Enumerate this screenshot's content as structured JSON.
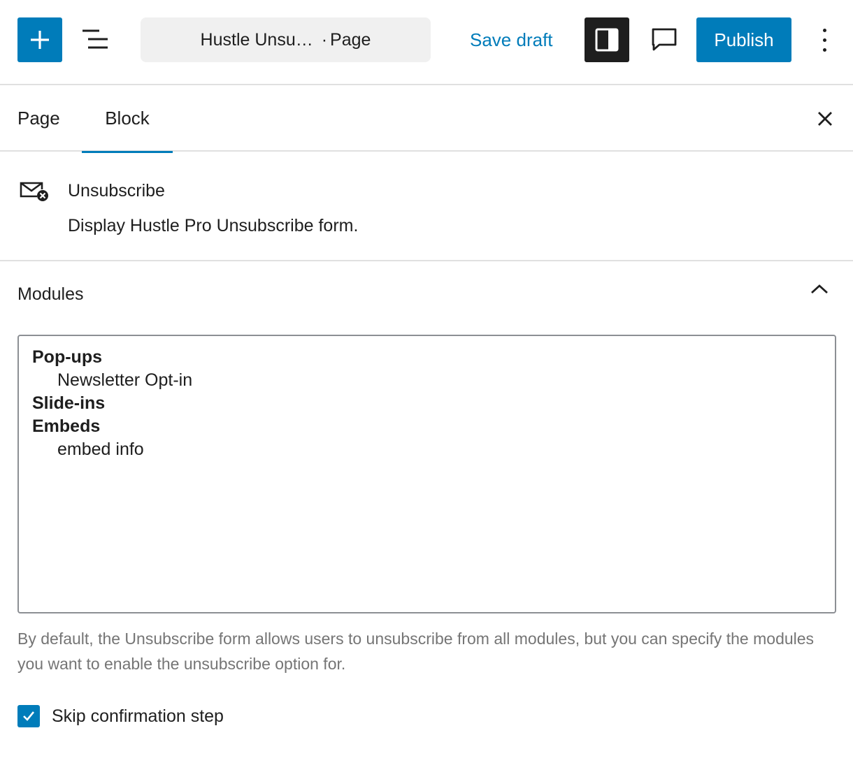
{
  "header": {
    "add_icon": "plus-icon",
    "list_view_icon": "list-view-icon",
    "document_title": "Hustle Unsu…",
    "separator": "·",
    "document_type": "Page",
    "save_draft_label": "Save draft",
    "settings_icon": "sidebar-toggle-icon",
    "comments_icon": "comment-icon",
    "publish_label": "Publish",
    "more_icon": "more-vertical-icon",
    "colors": {
      "accent": "#007cba",
      "dark": "#1e1e1e"
    }
  },
  "sidebar": {
    "tabs": [
      {
        "label": "Page",
        "active": false
      },
      {
        "label": "Block",
        "active": true
      }
    ],
    "close_icon": "close-icon",
    "block": {
      "icon": "mail-unsubscribe-icon",
      "title": "Unsubscribe",
      "description": "Display Hustle Pro Unsubscribe form."
    },
    "modules_panel": {
      "title": "Modules",
      "expanded": true,
      "groups": [
        {
          "label": "Pop-ups",
          "options": [
            "Newsletter Opt-in"
          ]
        },
        {
          "label": "Slide-ins",
          "options": []
        },
        {
          "label": "Embeds",
          "options": [
            "embed info"
          ]
        }
      ],
      "help": "By default, the Unsubscribe form allows users to unsubscribe from all modules, but you can specify the modules you want to enable the unsubscribe option for."
    },
    "skip_confirmation": {
      "label": "Skip confirmation step",
      "checked": true
    }
  }
}
